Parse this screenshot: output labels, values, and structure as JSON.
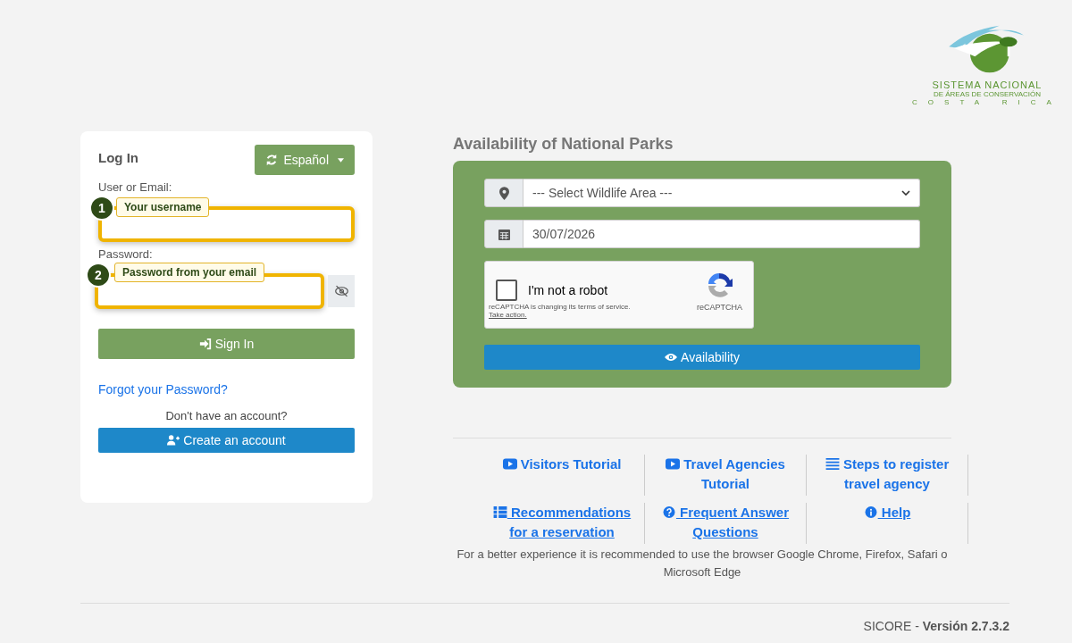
{
  "logo": {
    "lines": [
      "SISTEMA NACIONAL",
      "DE ÁREAS DE CONSERVACIÓN",
      "COSTA RICA"
    ]
  },
  "login": {
    "title": "Log In",
    "language_button": "Español",
    "fields": [
      {
        "label": "User or Email:",
        "callout_number": "1",
        "callout": "Your username",
        "kind": "text"
      },
      {
        "label": "Password:",
        "callout_number": "2",
        "callout": "Password from your email",
        "kind": "password"
      }
    ],
    "sign_in": "Sign In",
    "forgot": "Forgot your Password?",
    "no_account": "Don't have an account?",
    "create": "Create an account"
  },
  "availability": {
    "title": "Availability of National Parks",
    "area_placeholder": "--- Select Wildlife Area ---",
    "date": "30/07/2026",
    "captcha": {
      "label": "I'm not a robot",
      "checked": false,
      "notice": "reCAPTCHA is changing its terms of service.",
      "action": "Take action.",
      "brand": "reCAPTCHA"
    },
    "button": "Availability"
  },
  "links": [
    {
      "text": "Visitors Tutorial",
      "kind": "video",
      "underlined": false
    },
    {
      "text": "Travel Agencies Tutorial",
      "kind": "video",
      "underlined": false
    },
    {
      "text": "Steps to register travel agency",
      "kind": "list",
      "underlined": false
    },
    {
      "text": "Recommendations for a reservation",
      "kind": "table",
      "underlined": true
    },
    {
      "text": "Frequent Answer Questions",
      "kind": "question",
      "underlined": true
    },
    {
      "text": "Help",
      "kind": "info",
      "underlined": true
    }
  ],
  "browser_note": "For a better experience it is recommended to use the browser Google Chrome, Firefox, Safari o Microsoft Edge",
  "footer": {
    "app": "SICORE - ",
    "version": "Versión 2.7.3.2"
  }
}
